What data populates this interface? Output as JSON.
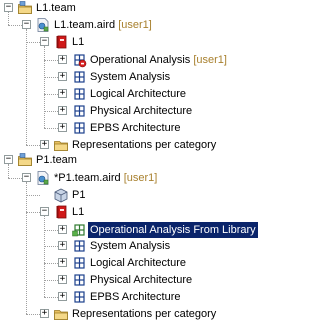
{
  "tree": {
    "nodes": [
      {
        "label": "L1.team",
        "user": "",
        "icon": "project-folder-icon",
        "expandable": true,
        "expanded": true
      },
      {
        "label": "L1.team.aird",
        "user": "[user1]",
        "icon": "aird-file-icon",
        "expandable": true,
        "expanded": true
      },
      {
        "label": "L1",
        "user": "",
        "icon": "model-book-icon",
        "expandable": true,
        "expanded": true
      },
      {
        "label": "Operational Analysis",
        "user": "[user1]",
        "icon": "locked-package-icon",
        "expandable": true,
        "expanded": false
      },
      {
        "label": "System Analysis",
        "user": "",
        "icon": "grid-package-icon",
        "expandable": true,
        "expanded": false
      },
      {
        "label": "Logical Architecture",
        "user": "",
        "icon": "grid-package-icon",
        "expandable": true,
        "expanded": false
      },
      {
        "label": "Physical Architecture",
        "user": "",
        "icon": "grid-package-icon",
        "expandable": true,
        "expanded": false
      },
      {
        "label": "EPBS Architecture",
        "user": "",
        "icon": "grid-package-icon",
        "expandable": true,
        "expanded": false
      },
      {
        "label": "Representations per category",
        "user": "",
        "icon": "folder-icon",
        "expandable": true,
        "expanded": false
      },
      {
        "label": "P1.team",
        "user": "",
        "icon": "project-folder-icon",
        "expandable": true,
        "expanded": true
      },
      {
        "label": "*P1.team.aird",
        "user": "[user1]",
        "icon": "aird-file-icon",
        "expandable": true,
        "expanded": true
      },
      {
        "label": "P1",
        "user": "",
        "icon": "library-package-icon",
        "expandable": false,
        "expanded": false
      },
      {
        "label": "L1",
        "user": "",
        "icon": "model-book-icon",
        "expandable": true,
        "expanded": true
      },
      {
        "label": "Operational Analysis From Library",
        "user": "",
        "icon": "library-grid-package-icon",
        "expandable": true,
        "expanded": false,
        "selected": true
      },
      {
        "label": "System Analysis",
        "user": "",
        "icon": "grid-package-icon",
        "expandable": true,
        "expanded": false
      },
      {
        "label": "Logical Architecture",
        "user": "",
        "icon": "grid-package-icon",
        "expandable": true,
        "expanded": false
      },
      {
        "label": "Physical Architecture",
        "user": "",
        "icon": "grid-package-icon",
        "expandable": true,
        "expanded": false
      },
      {
        "label": "EPBS Architecture",
        "user": "",
        "icon": "grid-package-icon",
        "expandable": true,
        "expanded": false
      },
      {
        "label": "Representations per category",
        "user": "",
        "icon": "folder-icon",
        "expandable": true,
        "expanded": false
      }
    ]
  },
  "colors": {
    "user_tag": "#a8802e",
    "selection_bg": "#0a246a",
    "selection_text": "#ffffff",
    "book_red": "#d01818",
    "grid_blue": "#1c3f8c",
    "folder_yellow": "#e8c060"
  }
}
